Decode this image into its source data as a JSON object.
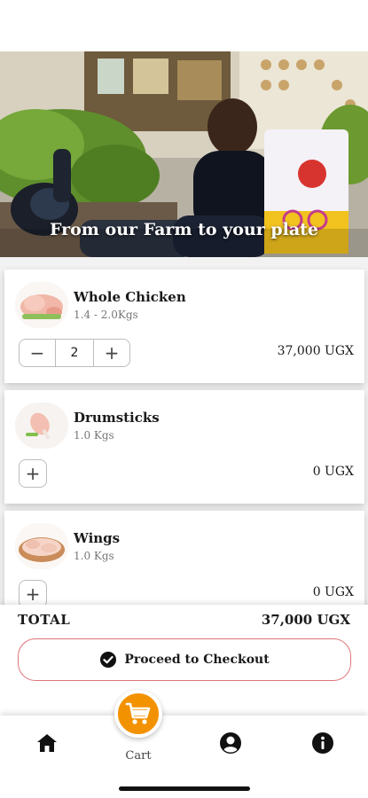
{
  "hero": {
    "caption": "From our Farm to your plate"
  },
  "products": [
    {
      "name": "Whole Chicken",
      "weight": "1.4 - 2.0Kgs",
      "quantity": "2",
      "price": "37,000 UGX",
      "in_cart": true
    },
    {
      "name": "Drumsticks",
      "weight": "1.0 Kgs",
      "price": "0 UGX",
      "in_cart": false
    },
    {
      "name": "Wings",
      "weight": "1.0 Kgs",
      "price": "0 UGX",
      "in_cart": false
    }
  ],
  "stepper": {
    "minus": "−",
    "plus": "+"
  },
  "summary": {
    "total_label": "TOTAL",
    "total_value": "37,000 UGX",
    "checkout_label": "Proceed to Checkout"
  },
  "nav": {
    "items": [
      {
        "icon": "home-icon"
      },
      {
        "icon": "cart-icon",
        "label": "Cart"
      },
      {
        "icon": "account-icon"
      },
      {
        "icon": "info-icon"
      }
    ]
  },
  "colors": {
    "accent": "#f39200",
    "checkout_border": "#e0747a"
  }
}
